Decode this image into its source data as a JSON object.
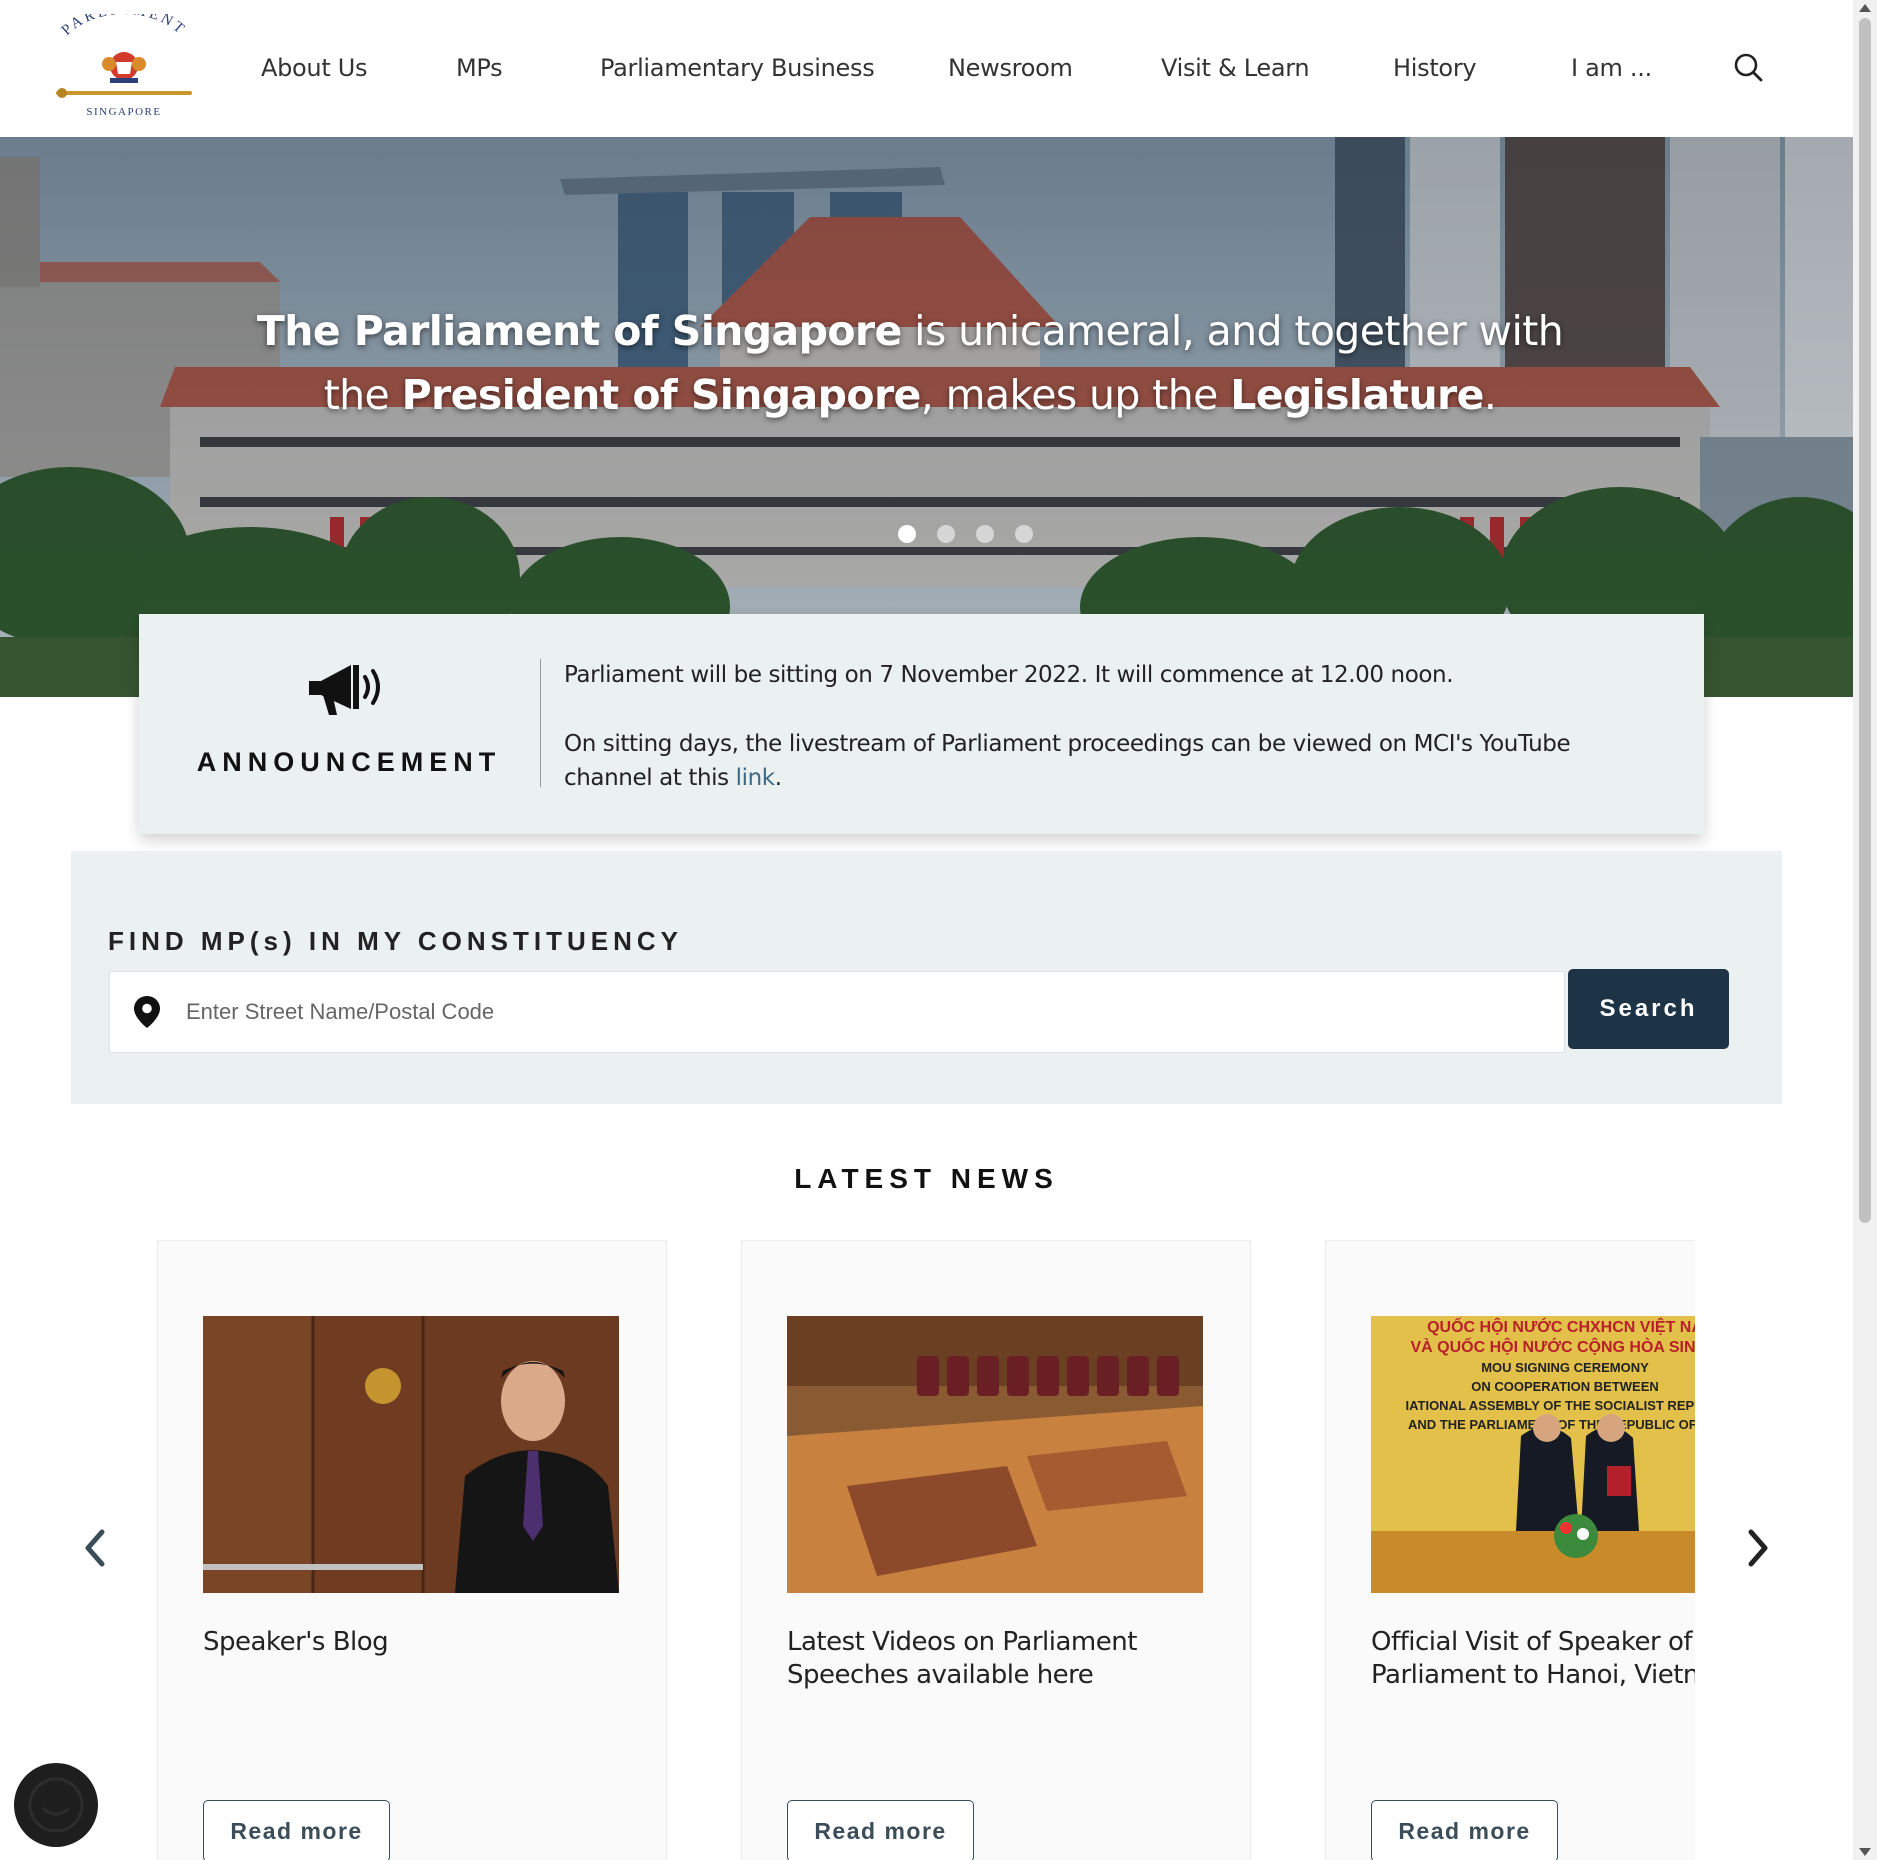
{
  "header": {
    "logo_text_top": "PARLIAMENT",
    "logo_text_bottom": "SINGAPORE",
    "nav": [
      {
        "label": "About Us"
      },
      {
        "label": "MPs"
      },
      {
        "label": "Parliamentary Business"
      },
      {
        "label": "Newsroom"
      },
      {
        "label": "Visit & Learn"
      },
      {
        "label": "History"
      },
      {
        "label": "I am ..."
      }
    ],
    "search_icon": "search-icon"
  },
  "hero": {
    "line1": [
      {
        "text": "The Parliament of Singapore",
        "bold": true
      },
      {
        "text": " is unicameral, and together with",
        "bold": false
      }
    ],
    "line2": [
      {
        "text": "the ",
        "bold": false
      },
      {
        "text": "President of Singapore",
        "bold": true
      },
      {
        "text": ", makes up the ",
        "bold": false
      },
      {
        "text": "Legislature",
        "bold": true
      },
      {
        "text": ".",
        "bold": false
      }
    ],
    "slides_total": 4,
    "active_slide": 1
  },
  "announcement": {
    "title": "ANNOUNCEMENT",
    "icon": "megaphone-icon",
    "paragraph1": "Parliament will be sitting on 7 November 2022. It will commence at 12.00 noon.",
    "paragraph2_prefix": "On sitting days, the livestream of Parliament proceedings can be viewed on MCI's YouTube channel at this ",
    "paragraph2_link": "link",
    "paragraph2_suffix": "."
  },
  "find_mp": {
    "title": "FIND MP(s) IN MY CONSTITUENCY",
    "placeholder": "Enter Street Name/Postal Code",
    "value": "",
    "button_label": "Search",
    "icon": "map-pin-icon"
  },
  "news": {
    "title": "LATEST NEWS",
    "cards": [
      {
        "title": "Speaker's Blog",
        "button": "Read more"
      },
      {
        "title": "Latest Videos on Parliament Speeches available here",
        "button": "Read more"
      },
      {
        "title": "Official Visit of Speaker of Parliament to Hanoi, Vietnam",
        "button": "Read more"
      }
    ],
    "card3_banner": {
      "line1": "QUỐC HỘI NƯỚC CHXHCN VIỆT NA",
      "line2": "VÀ QUỐC HỘI NƯỚC CỘNG HÒA SINGA",
      "line3": "MOU SIGNING CEREMONY",
      "line4": "ON COOPERATION BETWEEN",
      "line5": "IATIONAL ASSEMBLY OF THE SOCIALIST REPUBLI",
      "line6": "AND THE PARLIAMENT OF THE REPUBLIC OF SIN"
    },
    "prev_icon": "chevron-left-icon",
    "next_icon": "chevron-right-icon"
  },
  "colors": {
    "accent_dark": "#1c3445",
    "panel_bg": "#ebf0f1",
    "link": "#3b6a86"
  }
}
